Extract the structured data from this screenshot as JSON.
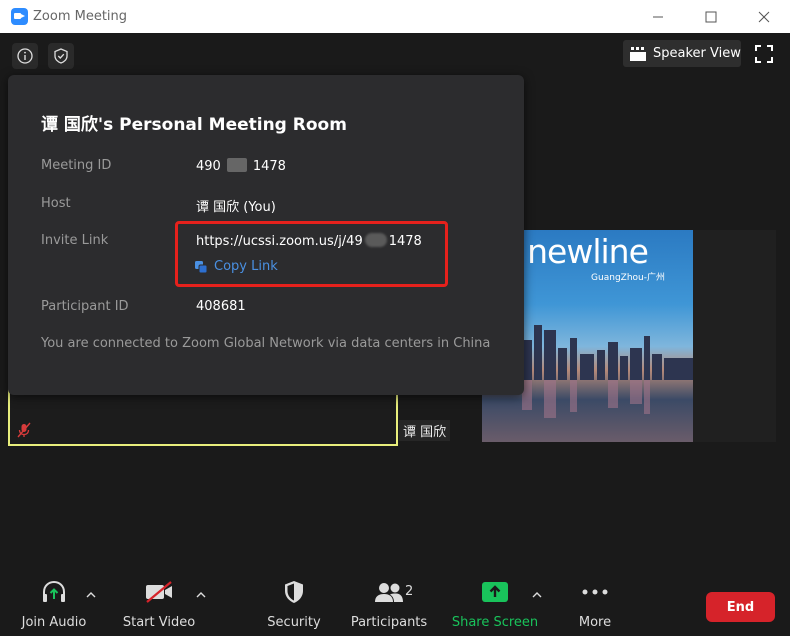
{
  "window": {
    "title": "Zoom Meeting"
  },
  "top_bar": {
    "speaker_view_label": "Speaker View"
  },
  "info_popup": {
    "title": "谭 国欣's Personal Meeting Room",
    "meeting_id": {
      "label": "Meeting ID",
      "prefix": "490",
      "suffix": "1478"
    },
    "host": {
      "label": "Host",
      "value": "谭 国欣 (You)"
    },
    "invite_link": {
      "label": "Invite Link",
      "prefix": "https://ucssi.zoom.us/j/49",
      "suffix": "1478",
      "copy_label": "Copy Link"
    },
    "participant_id": {
      "label": "Participant ID",
      "value": "408681"
    },
    "network_notice": "You are connected to Zoom Global Network via data centers in China"
  },
  "video": {
    "name_tag": "谭 国欣",
    "shared_image": {
      "brand": "newline",
      "subtitle": "GuangZhou-广州"
    }
  },
  "toolbar": {
    "join_audio": "Join Audio",
    "start_video": "Start Video",
    "security": "Security",
    "participants": "Participants",
    "participants_count": "2",
    "share_screen": "Share Screen",
    "more": "More",
    "end": "End"
  },
  "colors": {
    "accent": "#2d8cff",
    "link": "#4a90e2",
    "share_green": "#19c35b",
    "end_red": "#d6232a",
    "highlight": "#e6211c",
    "active_speaker": "#e8ee7c"
  }
}
